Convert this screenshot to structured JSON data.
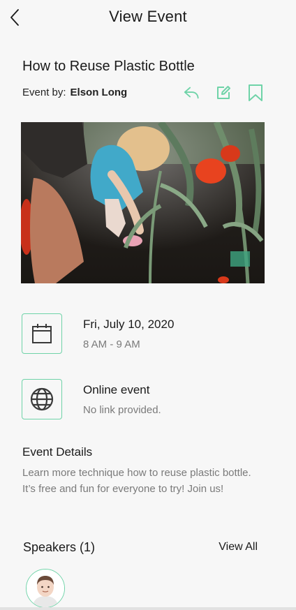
{
  "header": {
    "title": "View Event",
    "back_icon": "chevron-left-icon"
  },
  "event": {
    "title": "How to Reuse Plastic Bottle",
    "organizer_prefix": "Event by:",
    "organizer_name": "Elson Long"
  },
  "actions": [
    {
      "icon": "share-reply-icon"
    },
    {
      "icon": "edit-icon"
    },
    {
      "icon": "bookmark-icon"
    }
  ],
  "date": {
    "icon": "calendar-icon",
    "date_label": "Fri, July 10, 2020",
    "time_label": "8 AM - 9 AM"
  },
  "location": {
    "icon": "globe-icon",
    "type_label": "Online event",
    "link_label": "No link provided."
  },
  "details": {
    "heading": "Event Details",
    "description": "Learn more technique how to reuse plastic bottle. It’s free and fun for everyone to try! Join us!"
  },
  "speakers": {
    "heading": "Speakers (1)",
    "view_all_label": "View All"
  },
  "colors": {
    "accent": "#6fd3a8",
    "background": "#f7f7f7",
    "muted_text": "#7a7a7a"
  }
}
